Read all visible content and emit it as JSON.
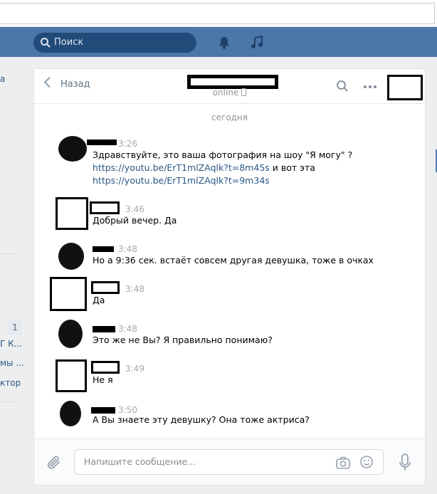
{
  "topbar": {
    "search_placeholder": "Поиск",
    "accent": "#4a76a8"
  },
  "left_sidebar": {
    "frag_1": "а",
    "badge": "1",
    "frag_2": "Г К...",
    "frag_3": "мы ...",
    "frag_4": "ктор"
  },
  "chat": {
    "back_label": "Назад",
    "status": "online",
    "day_label": "сегодня",
    "messages": [
      {
        "time": "3:26",
        "line1": "Здравствуйте, это ваша фотография на шоу \"Я могу\" ?",
        "link1": "https://youtu.be/ErT1mlZAqlk?t=8m45s",
        "mid": " и вот эта",
        "link2": "https://youtu.be/ErT1mlZAqlk?t=9m34s"
      },
      {
        "time": "3:46",
        "text": "Добрый вечер. Да"
      },
      {
        "time": "3:48",
        "text": "Но а 9:36 сек. встаёт совсем другая девушка, тоже в очках"
      },
      {
        "time": "3:48",
        "text": "Да"
      },
      {
        "time": "3:48",
        "text": "Это же не Вы? Я правильно понимаю?"
      },
      {
        "time": "3:49",
        "text": "Не я"
      },
      {
        "time": "3:50",
        "text": "А Вы знаете эту девушку? Она тоже актриса?"
      }
    ]
  },
  "composer": {
    "placeholder": "Напишите сообщение..."
  }
}
